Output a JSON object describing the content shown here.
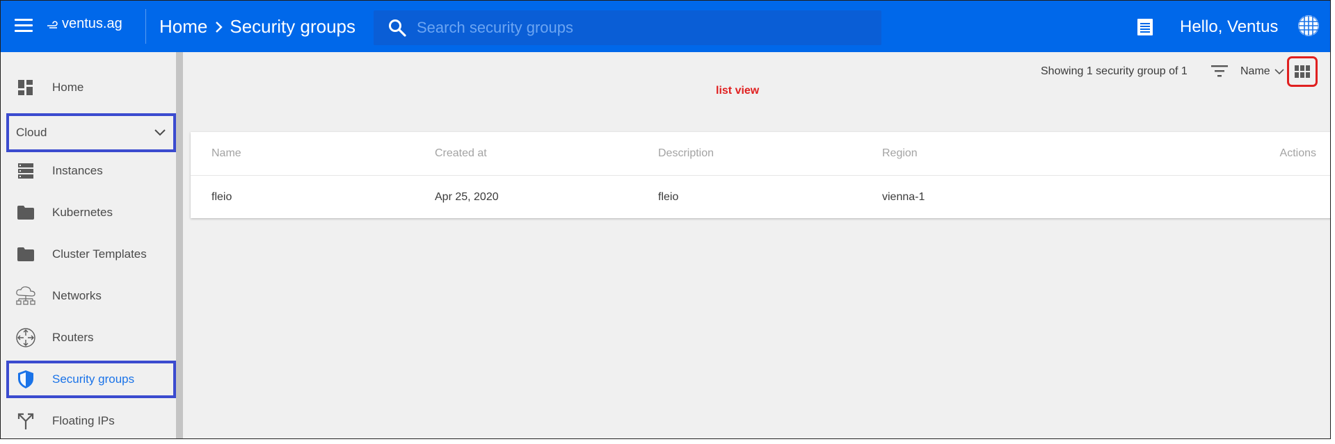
{
  "header": {
    "logo_text": "ventus.ag",
    "breadcrumb": [
      "Home",
      "Security groups"
    ],
    "search_placeholder": "Search security groups",
    "greeting": "Hello, Ventus"
  },
  "sidebar": {
    "items": [
      {
        "label": "Home",
        "icon": "dashboard-icon"
      },
      {
        "label": "Cloud",
        "icon": "chevron-down-icon"
      },
      {
        "label": "Instances",
        "icon": "server-icon"
      },
      {
        "label": "Kubernetes",
        "icon": "folder-icon"
      },
      {
        "label": "Cluster Templates",
        "icon": "folder-icon"
      },
      {
        "label": "Networks",
        "icon": "cloud-network-icon"
      },
      {
        "label": "Routers",
        "icon": "router-icon"
      },
      {
        "label": "Security groups",
        "icon": "shield-icon"
      },
      {
        "label": "Floating IPs",
        "icon": "split-arrow-icon"
      }
    ]
  },
  "toolbar": {
    "count_text": "Showing 1 security group of 1",
    "sort_label": "Name"
  },
  "annotation": "list view",
  "table": {
    "columns": [
      "Name",
      "Created at",
      "Description",
      "Region",
      "Actions"
    ],
    "rows": [
      [
        "fleio",
        "Apr 25, 2020",
        "fleio",
        "vienna-1",
        ""
      ]
    ]
  },
  "colors": {
    "header_bg": "#0068ea",
    "accent": "#1a73e8",
    "highlight_box": "#3b4bcf",
    "annotation": "#e02020"
  }
}
